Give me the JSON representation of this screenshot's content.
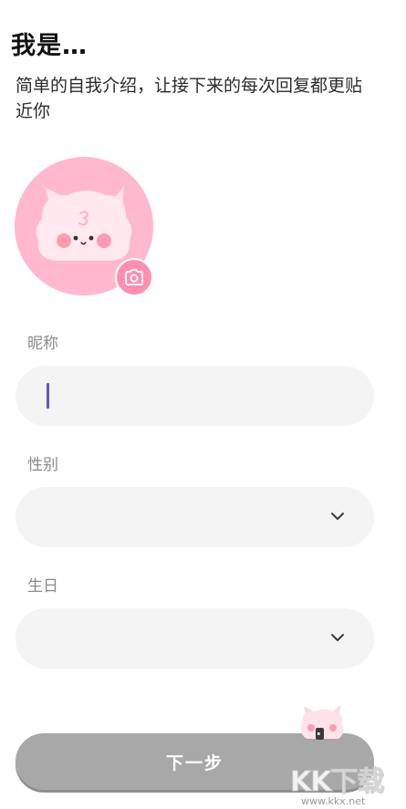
{
  "header": {
    "title": "我是…",
    "subtitle": "简单的自我介绍，让接下来的每次回复都更贴近你"
  },
  "avatar": {
    "icon": "cat-avatar-icon",
    "camera_icon": "camera-icon",
    "bg_color": "#ffb8cd",
    "accent_color": "#ff8fb1"
  },
  "form": {
    "nickname": {
      "label": "昵称",
      "value": ""
    },
    "gender": {
      "label": "性别",
      "value": ""
    },
    "birthday": {
      "label": "生日",
      "value": ""
    }
  },
  "next_button": {
    "label": "下一步",
    "state": "disabled"
  },
  "watermark": {
    "text": "KK下载",
    "url": "www.kkx.net"
  }
}
